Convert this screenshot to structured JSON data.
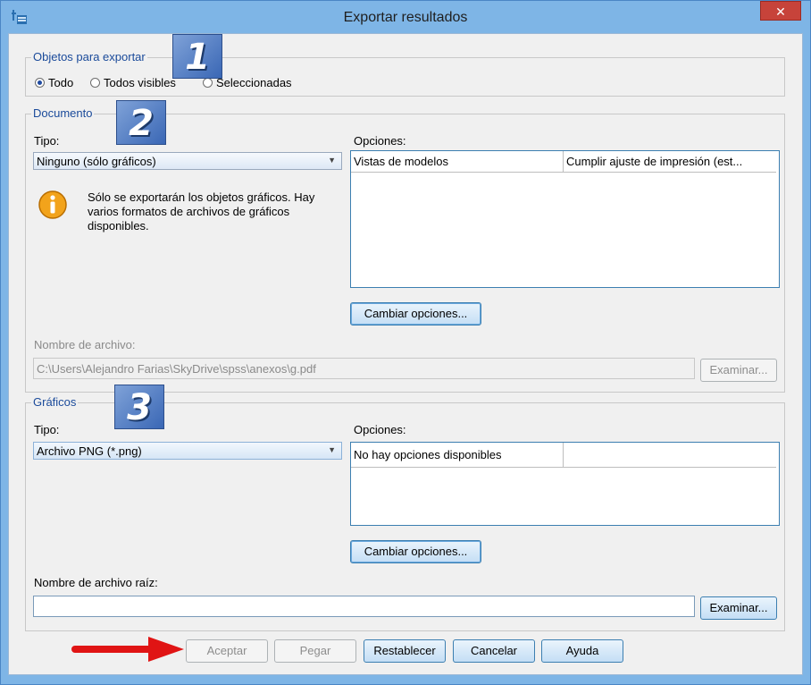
{
  "window": {
    "title": "Exportar resultados",
    "close_glyph": "✕"
  },
  "objects": {
    "legend": "Objetos para exportar",
    "radios": [
      {
        "label": "Todo",
        "selected": true
      },
      {
        "label": "Todos visibles",
        "selected": false
      },
      {
        "label": "Seleccionadas",
        "selected": false
      }
    ]
  },
  "badges": [
    "1",
    "2",
    "3"
  ],
  "document": {
    "legend": "Documento",
    "type_label": "Tipo:",
    "type_value": "Ninguno (sólo gráficos)",
    "info_text": "Sólo se exportarán los objetos gráficos. Hay varios formatos de archivos de gráficos disponibles.",
    "options_label": "Opciones:",
    "options_cells": [
      "Vistas de modelos",
      "Cumplir ajuste de impresión (est..."
    ],
    "change_options": "Cambiar opciones...",
    "filename_label": "Nombre de archivo:",
    "filename_value": "C:\\Users\\Alejandro Farias\\SkyDrive\\spss\\anexos\\g.pdf",
    "browse": "Examinar..."
  },
  "graphics": {
    "legend": "Gráficos",
    "type_label": "Tipo:",
    "type_value": "Archivo PNG (*.png)",
    "options_label": "Opciones:",
    "options_cells": [
      "No hay opciones disponibles",
      ""
    ],
    "change_options": "Cambiar opciones...",
    "root_label": "Nombre de archivo raíz:",
    "root_value": "",
    "browse": "Examinar..."
  },
  "buttons": {
    "accept": "Aceptar",
    "paste": "Pegar",
    "reset": "Restablecer",
    "cancel": "Cancelar",
    "help": "Ayuda"
  },
  "colors": {
    "title_bar": "#7eb5e6",
    "accent_blue": "#3c7fb1",
    "arrow_red": "#e01414"
  },
  "icons": {
    "info": "info-icon",
    "arrow": "red-arrow-icon"
  }
}
